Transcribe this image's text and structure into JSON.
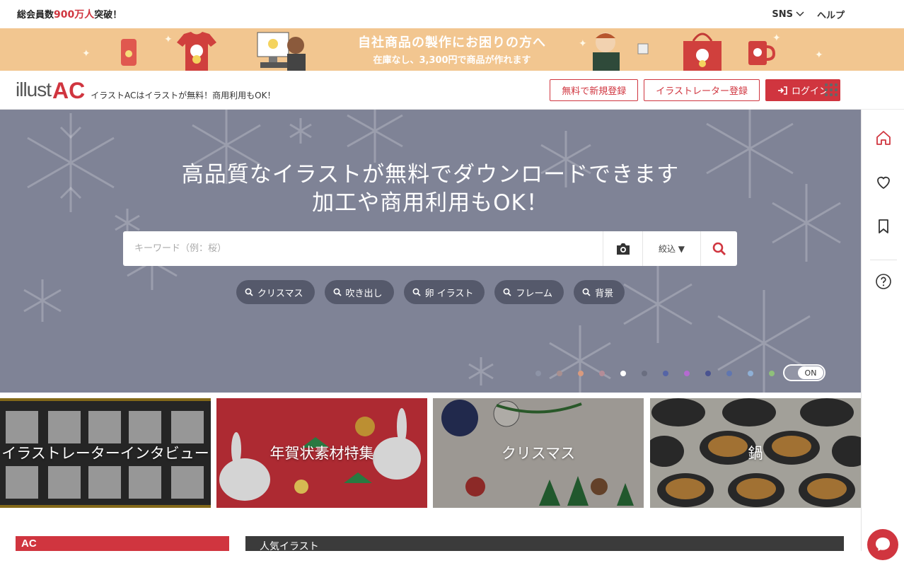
{
  "topbar": {
    "members_prefix": "総会員数",
    "members_count": "900万人",
    "members_suffix": "突破！",
    "sns_label": "SNS",
    "help_label": "ヘルプ"
  },
  "promo": {
    "line1": "自社商品の製作にお困りの方へ",
    "line2": "在庫なし、3,300円で商品が作れます"
  },
  "header": {
    "logo_a": "illust",
    "logo_b": "AC",
    "tagline": "イラストACはイラストが無料！商用利用もOK！",
    "register_label": "無料で新規登録",
    "illustrator_label": "イラストレーター登録",
    "login_label": "ログイン"
  },
  "hero": {
    "headline1": "高品質なイラストが無料でダウンロードできます",
    "headline2": "加工や商用利用もOK！",
    "search_placeholder": "キーワード（例：桜）",
    "filter_label": "絞込 ▼",
    "chips": [
      "クリスマス",
      "吹き出し",
      "卵 イラスト",
      "フレーム",
      "背景"
    ],
    "toggle_label": "ON",
    "dot_colors": [
      "#8d93a6",
      "#a88f8f",
      "#d99a7e",
      "#b48c97",
      "#ffffff",
      "#6a6e80",
      "#5564a6",
      "#b46ad0",
      "#4a5390",
      "#6076b0",
      "#8fb0d6",
      "#8fc07a"
    ]
  },
  "tiles": [
    {
      "label": "イラストレーターインタビュー",
      "bg": "#2d2d2d"
    },
    {
      "label": "年賀状素材特集",
      "bg": "#c5303a"
    },
    {
      "label": "クリスマス",
      "bg": "#a8a29a"
    },
    {
      "label": "鍋",
      "bg": "#8a8a86"
    }
  ],
  "bottom": {
    "section_title": "人気イラスト"
  }
}
